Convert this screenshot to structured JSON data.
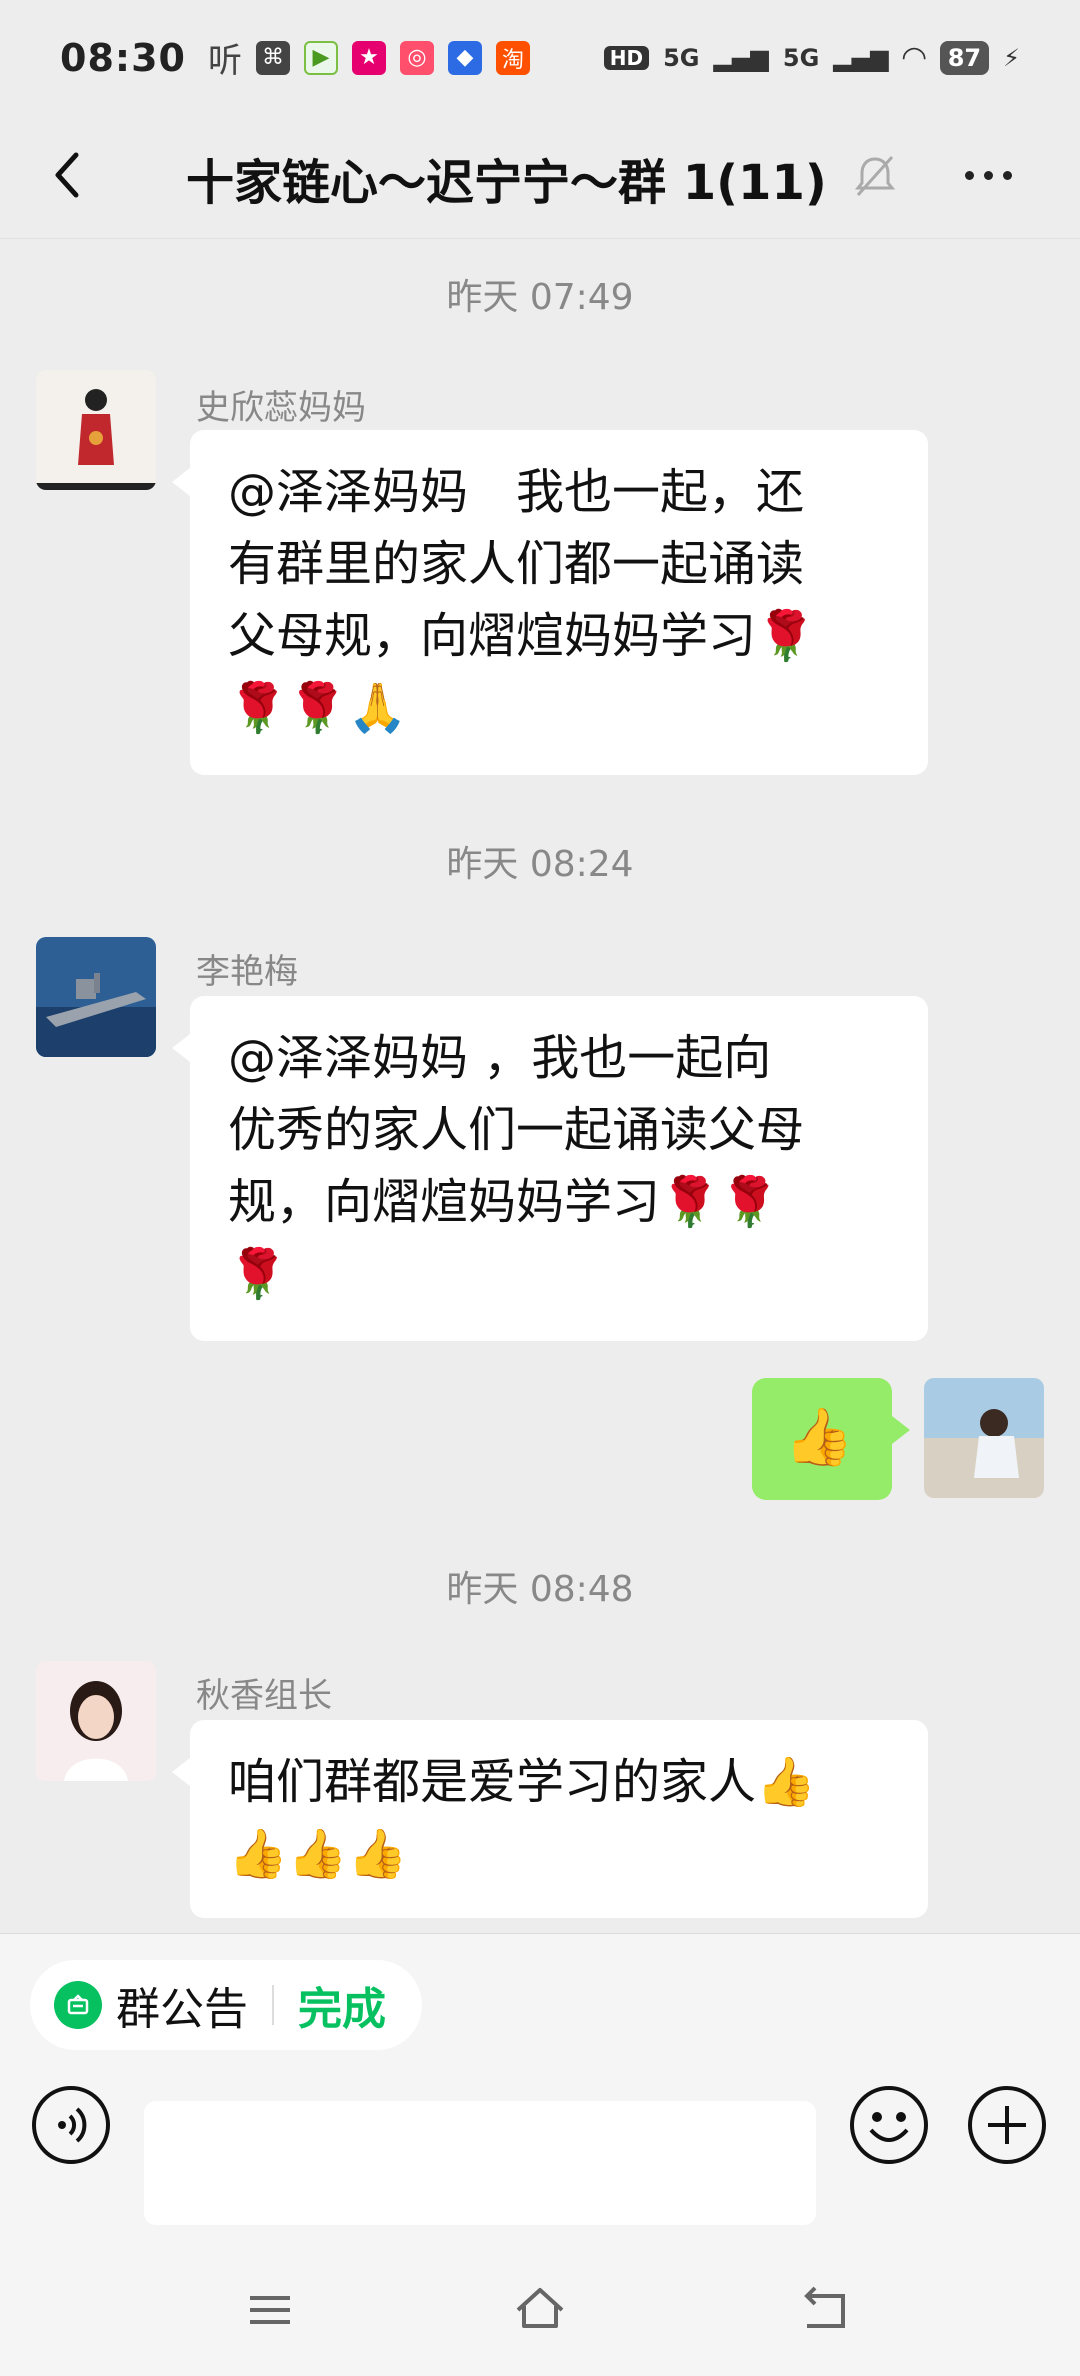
{
  "status": {
    "time": "08:30",
    "left_icons": [
      "听",
      "scan-icon",
      "app-icon-1",
      "app-icon-2",
      "app-icon-3",
      "app-icon-4",
      "淘"
    ],
    "hd": "HD",
    "net1": "5G",
    "net2": "5G",
    "battery": "87"
  },
  "header": {
    "title": "十家链心～迟宁宁～群 1(11)"
  },
  "messages": [
    {
      "time": "昨天 07:49",
      "sender": "史欣蕊妈妈",
      "lines": [
        "@泽泽妈妈　我也一起，还",
        "有群里的家人们都一起诵读",
        "父母规，向熠煊妈妈学习🌹",
        "🌹🌹🙏"
      ]
    },
    {
      "time": "昨天 08:24",
      "sender": "李艳梅",
      "lines": [
        "@泽泽妈妈 ，我也一起向",
        "优秀的家人们一起诵读父母",
        "规，向熠煊妈妈学习🌹🌹",
        "🌹"
      ]
    },
    {
      "mine": true,
      "text": "👍"
    },
    {
      "time": "昨天 08:48",
      "sender": "秋香组长",
      "lines": [
        "咱们群都是爱学习的家人👍",
        "👍👍👍"
      ]
    }
  ],
  "bottom": {
    "notice_label": "群公告",
    "done_label": "完成"
  },
  "colors": {
    "accent": "#07c160",
    "my_bubble": "#95ec69",
    "background": "#ededed"
  }
}
